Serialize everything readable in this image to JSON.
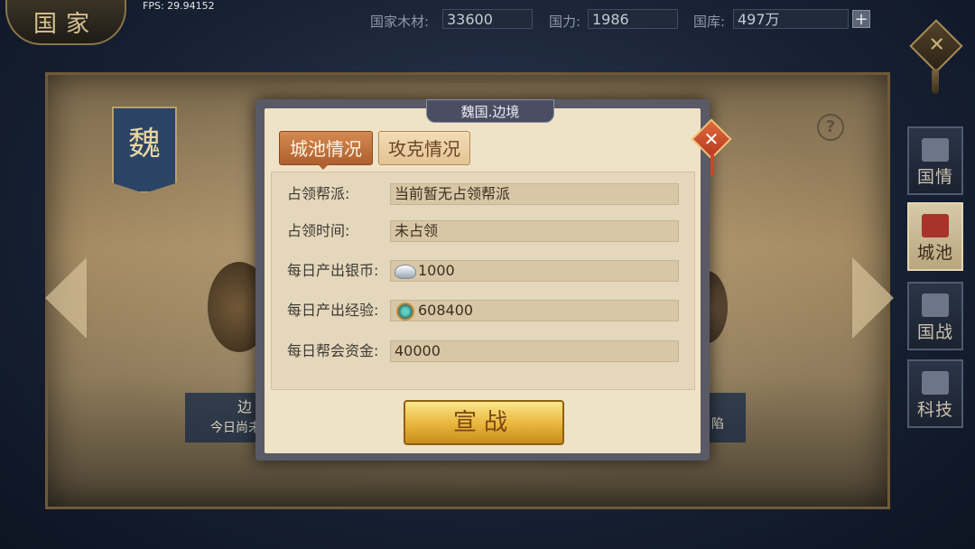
{
  "app": {
    "title": "国家",
    "fps": "FPS: 29.94152"
  },
  "resources": {
    "wood_label": "国家木材:",
    "wood_value": "33600",
    "power_label": "国力:",
    "power_value": "1986",
    "treasury_label": "国库:",
    "treasury_value": "497万",
    "plus": "+"
  },
  "header": {
    "close_glyph": "✕"
  },
  "background": {
    "banner_text": "魏",
    "help_glyph": "?",
    "left_strip_title": "边",
    "left_strip_sub": "今日尚未",
    "right_strip_sub": "陷"
  },
  "side_nav": [
    {
      "label": "国情",
      "icon": "book-icon"
    },
    {
      "label": "城池",
      "icon": "palace-icon"
    },
    {
      "label": "国战",
      "icon": "war-icon"
    },
    {
      "label": "科技",
      "icon": "tech-icon"
    }
  ],
  "dialog": {
    "title": "魏国.边境",
    "close_glyph": "✕",
    "tabs": [
      {
        "label": "城池情况",
        "active": true
      },
      {
        "label": "攻克情况",
        "active": false
      }
    ],
    "rows": [
      {
        "label": "占领帮派:",
        "value": "当前暂无占领帮派"
      },
      {
        "label": "占领时间:",
        "value": "未占领"
      },
      {
        "label": "每日产出银币:",
        "value": "1000",
        "icon": "silver-coin-icon"
      },
      {
        "label": "每日产出经验:",
        "value": "608400",
        "icon": "exp-icon"
      },
      {
        "label": "每日帮会资金:",
        "value": "40000"
      }
    ],
    "action_label": "宣战"
  }
}
